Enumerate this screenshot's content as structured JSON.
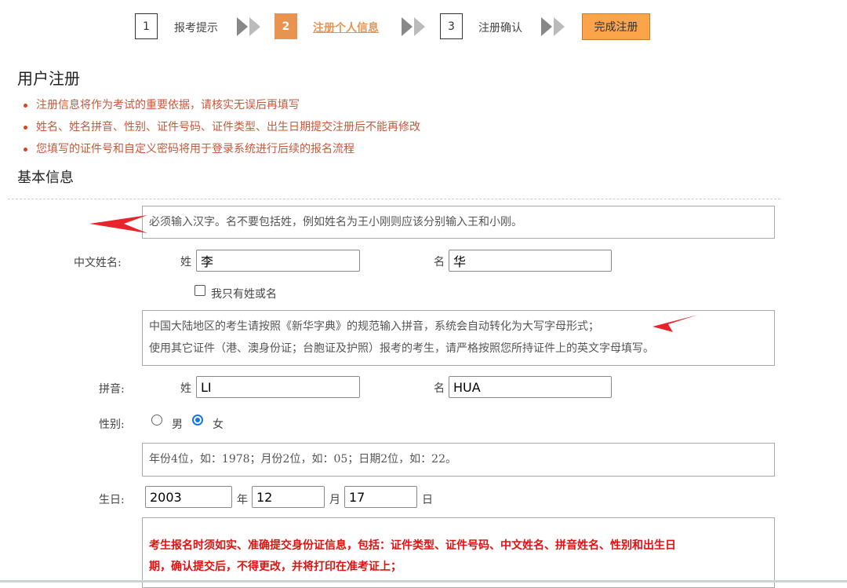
{
  "steps": [
    {
      "num": "1",
      "label": "报考提示"
    },
    {
      "num": "2",
      "label": "注册个人信息"
    },
    {
      "num": "3",
      "label": "注册确认"
    }
  ],
  "finish_label": "完成注册",
  "page_title": "用户注册",
  "notes": [
    "注册信息将作为考试的重要依据，请核实无误后再填写",
    "姓名、姓名拼音、性别、证件号码、证件类型、出生日期提交注册后不能再修改",
    "您填写的证件号和自定义密码将用于登录系统进行后续的报名流程"
  ],
  "section_title": "基本信息",
  "name_hint": "必须输入汉字。名不要包括姓，例如姓名为王小刚则应该分别输入王和小刚。",
  "chinese_name": {
    "label": "中文姓名:",
    "surname_label": "姓",
    "surname_value": "李",
    "given_label": "名",
    "given_value": "华",
    "single_name_label": "我只有姓或名"
  },
  "pinyin_hint": {
    "line1": "中国大陆地区的考生请按照《新华字典》的规范输入拼音，系统会自动转化为大写字母形式；",
    "line2": "使用其它证件（港、澳身份证；台胞证及护照）报考的考生，请严格按照您所持证件上的英文字母填写。"
  },
  "pinyin": {
    "label": "拼音:",
    "surname_label": "姓",
    "surname_value": "LI",
    "given_label": "名",
    "given_value": "HUA"
  },
  "gender": {
    "label": "性别:",
    "male": "男",
    "female": "女",
    "selected": "女"
  },
  "birth_hint": "年份4位，如：1978；月份2位，如：05；日期2位，如：22。",
  "birth": {
    "label": "生日:",
    "year_value": "2003",
    "year_label": "年",
    "month_value": "12",
    "month_label": "月",
    "day_value": "17",
    "day_label": "日"
  },
  "id_hint": {
    "line1": "考生报名时须如实、准确提交身份证信息，包括：证件类型、证件号码、中文姓名、拼音姓名、性别和出生日",
    "line2": "期，确认提交后，不得更改，并将打印在准考证上；"
  },
  "colors": {
    "active_step": "#e8934f",
    "finish_button": "#fba449",
    "note_text": "#c9573a",
    "annotation_arrow": "#e8242a",
    "warning_text": "#e0110f",
    "radio_selected": "#1a73e8"
  }
}
